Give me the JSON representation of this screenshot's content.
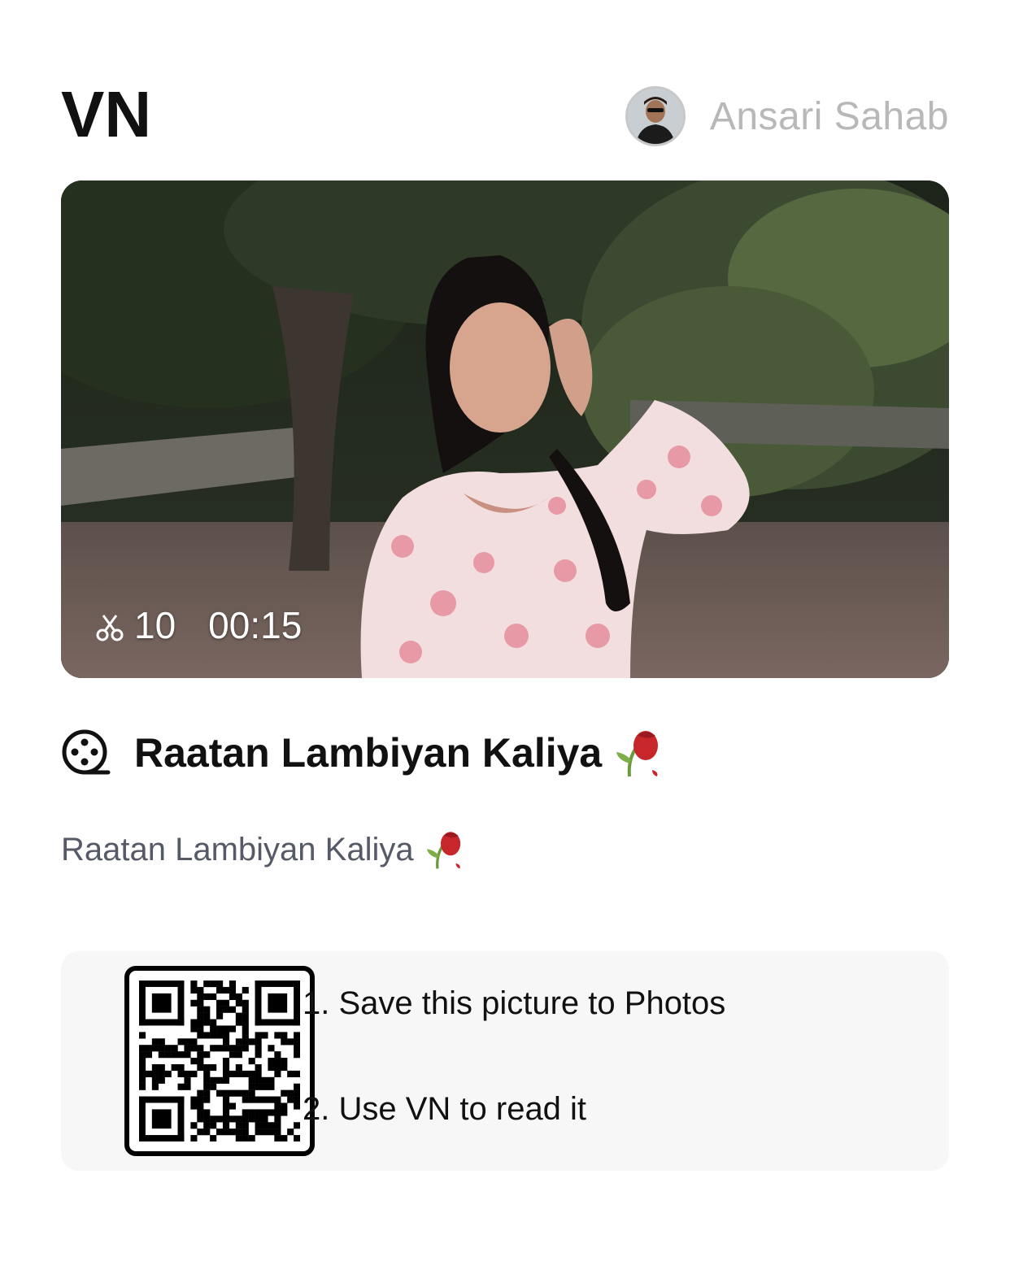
{
  "header": {
    "logo_text": "VN",
    "username": "Ansari Sahab",
    "avatar_icon": "user-avatar"
  },
  "video": {
    "clip_count": "10",
    "duration": "00:15",
    "clip_icon": "scissors-icon"
  },
  "project": {
    "title": "Raatan Lambiyan Kaliya",
    "title_emoji": "wilted-rose",
    "description": "Raatan Lambiyan Kaliya",
    "description_emoji": "wilted-rose",
    "icon": "film-reel-icon"
  },
  "qr_card": {
    "step1": "1. Save this picture to Photos",
    "step2": "2. Use VN to read it"
  },
  "colors": {
    "username": "#b8b8b8",
    "description": "#555a66",
    "card_background": "#f7f7f7"
  }
}
